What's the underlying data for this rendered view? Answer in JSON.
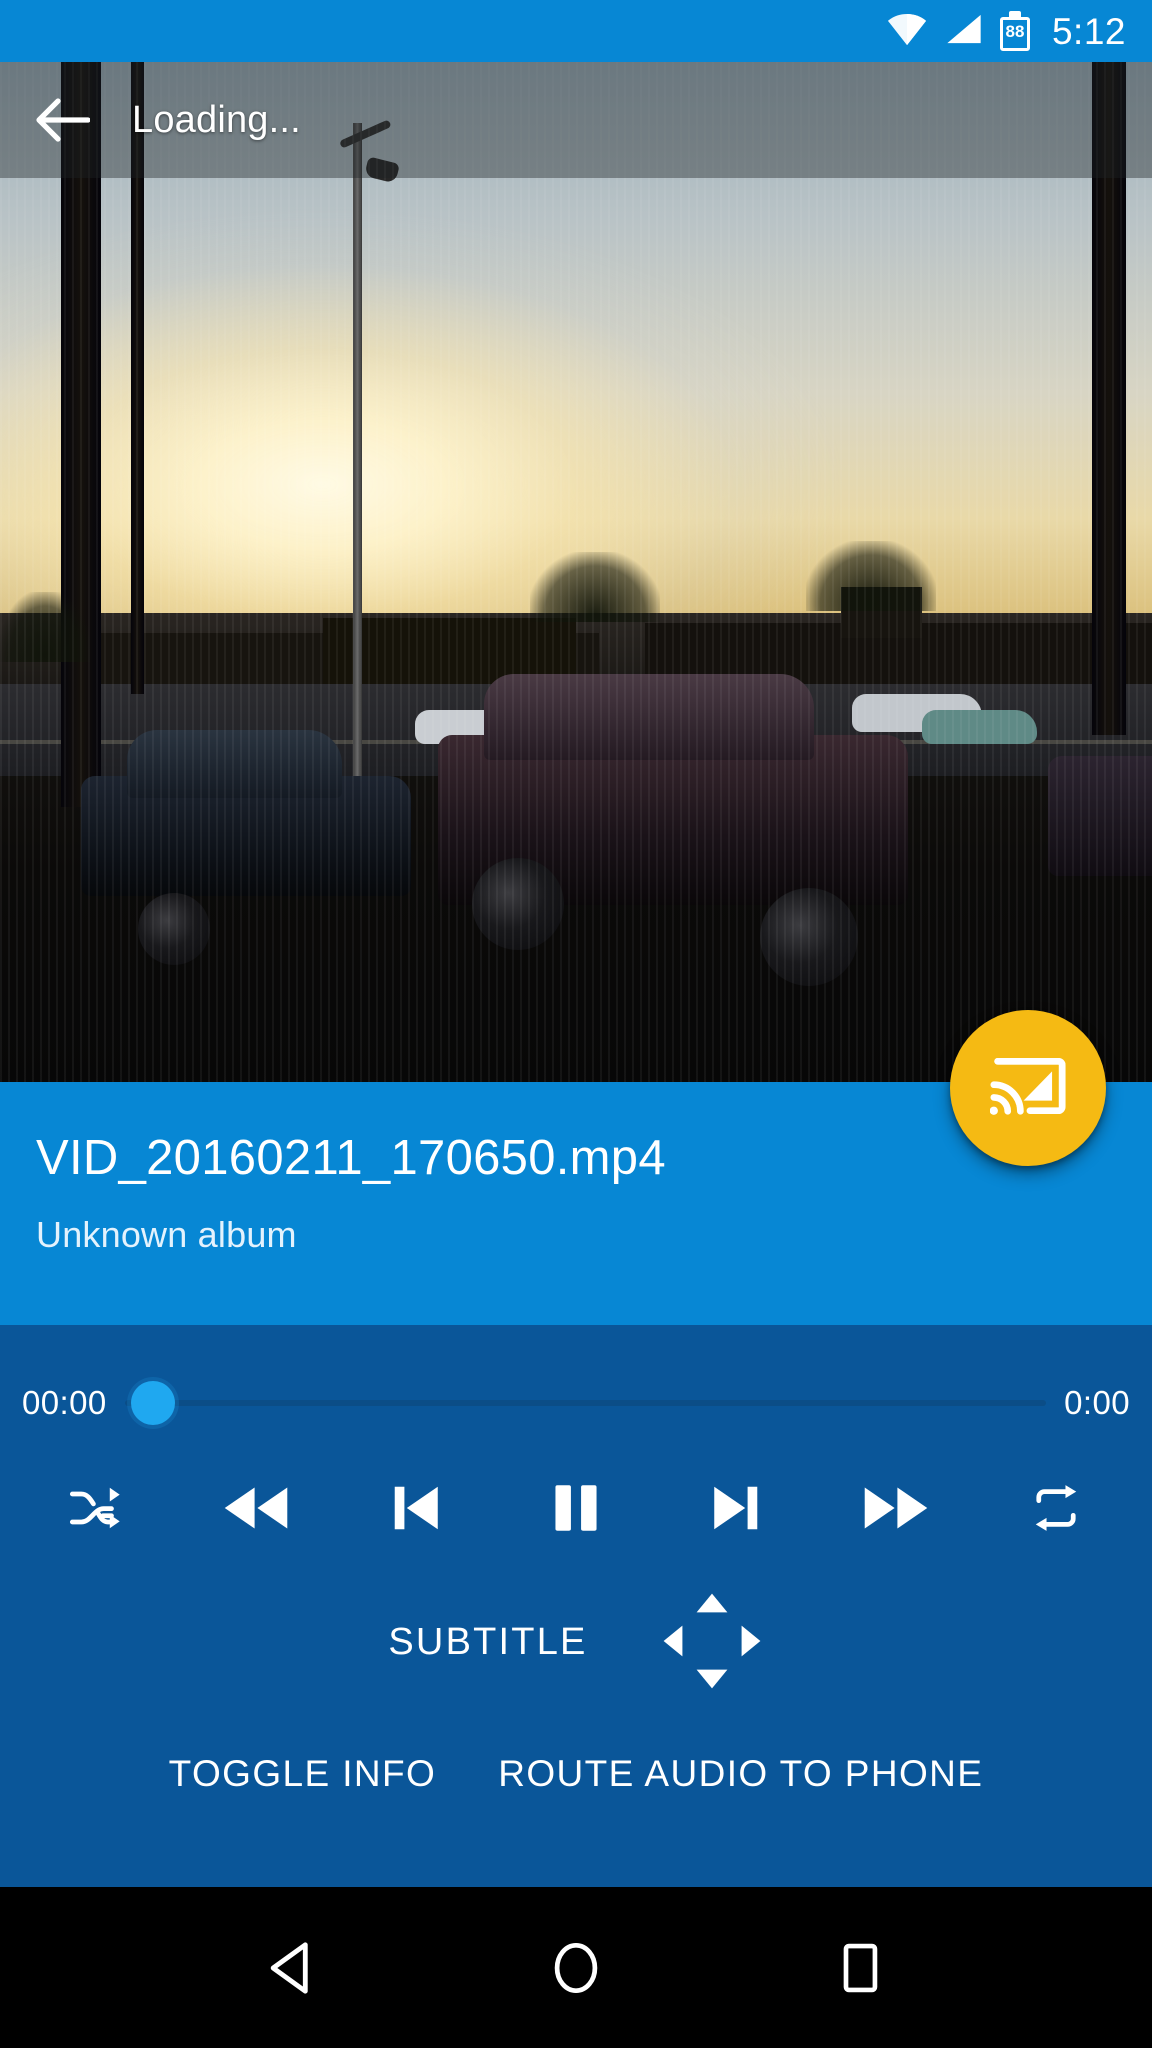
{
  "status_bar": {
    "wifi_icon": "wifi-icon",
    "signal_icon": "cell-signal-icon",
    "battery_icon": "battery-icon",
    "battery_level": "88",
    "time": "5:12",
    "background_color": "#0787d4"
  },
  "app_bar": {
    "back_icon": "back-arrow-icon",
    "title": "Loading..."
  },
  "video": {
    "description": "sunset over parking lot with palm trees and parked cars"
  },
  "cast_fab": {
    "icon": "cast-connected-icon",
    "color": "#f5ba13"
  },
  "metadata": {
    "title": "VID_20160211_170650.mp4",
    "album": "Unknown album",
    "background_color": "#0787d4"
  },
  "controls": {
    "background_color": "#0a5699",
    "seek": {
      "current_time": "00:00",
      "total_time": "0:00",
      "progress_percent": 0,
      "thumb_color": "#1fa8f0"
    },
    "buttons": [
      {
        "name": "shuffle-button",
        "icon": "shuffle-icon"
      },
      {
        "name": "rewind-button",
        "icon": "fast-rewind-icon"
      },
      {
        "name": "previous-track-button",
        "icon": "skip-previous-icon"
      },
      {
        "name": "pause-button",
        "icon": "pause-icon"
      },
      {
        "name": "next-track-button",
        "icon": "skip-next-icon"
      },
      {
        "name": "fast-forward-button",
        "icon": "fast-forward-icon"
      },
      {
        "name": "repeat-button",
        "icon": "repeat-icon"
      }
    ],
    "subtitle": {
      "label": "SUBTITLE",
      "up_icon": "triangle-up-icon",
      "down_icon": "triangle-down-icon",
      "left_icon": "triangle-left-icon",
      "right_icon": "triangle-right-icon"
    },
    "actions": [
      {
        "name": "toggle-info-button",
        "label": "TOGGLE INFO"
      },
      {
        "name": "route-audio-button",
        "label": "ROUTE AUDIO TO PHONE"
      }
    ]
  },
  "nav_bar": {
    "back_icon": "nav-back-triangle-icon",
    "home_icon": "nav-home-circle-icon",
    "recents_icon": "nav-recents-square-icon",
    "background_color": "#000000"
  }
}
